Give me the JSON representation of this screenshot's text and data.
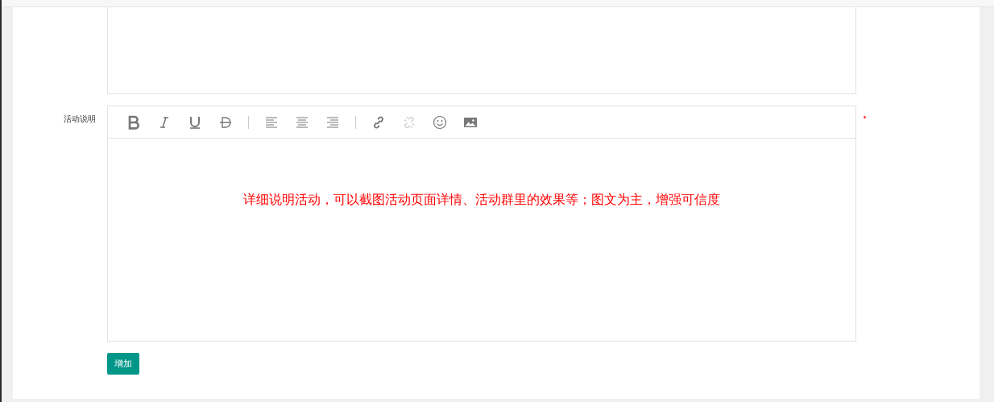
{
  "field": {
    "label": "活动说明",
    "required": true
  },
  "toolbar": [
    [
      {
        "kind": "bold",
        "disabled": false
      },
      {
        "kind": "italic",
        "disabled": false
      },
      {
        "kind": "underline",
        "disabled": false
      },
      {
        "kind": "strike",
        "disabled": false
      }
    ],
    [
      {
        "kind": "align-left",
        "disabled": false
      },
      {
        "kind": "align-center",
        "disabled": false
      },
      {
        "kind": "align-right",
        "disabled": false
      }
    ],
    [
      {
        "kind": "link",
        "disabled": false
      },
      {
        "kind": "unlink",
        "disabled": true
      },
      {
        "kind": "emoji",
        "disabled": false
      },
      {
        "kind": "image",
        "disabled": false
      }
    ]
  ],
  "editor": {
    "content": "详细说明活动，可以截图活动页面详情、活动群里的效果等；图文为主，增强可信度"
  },
  "buttons": [
    {
      "label": "增加"
    }
  ]
}
